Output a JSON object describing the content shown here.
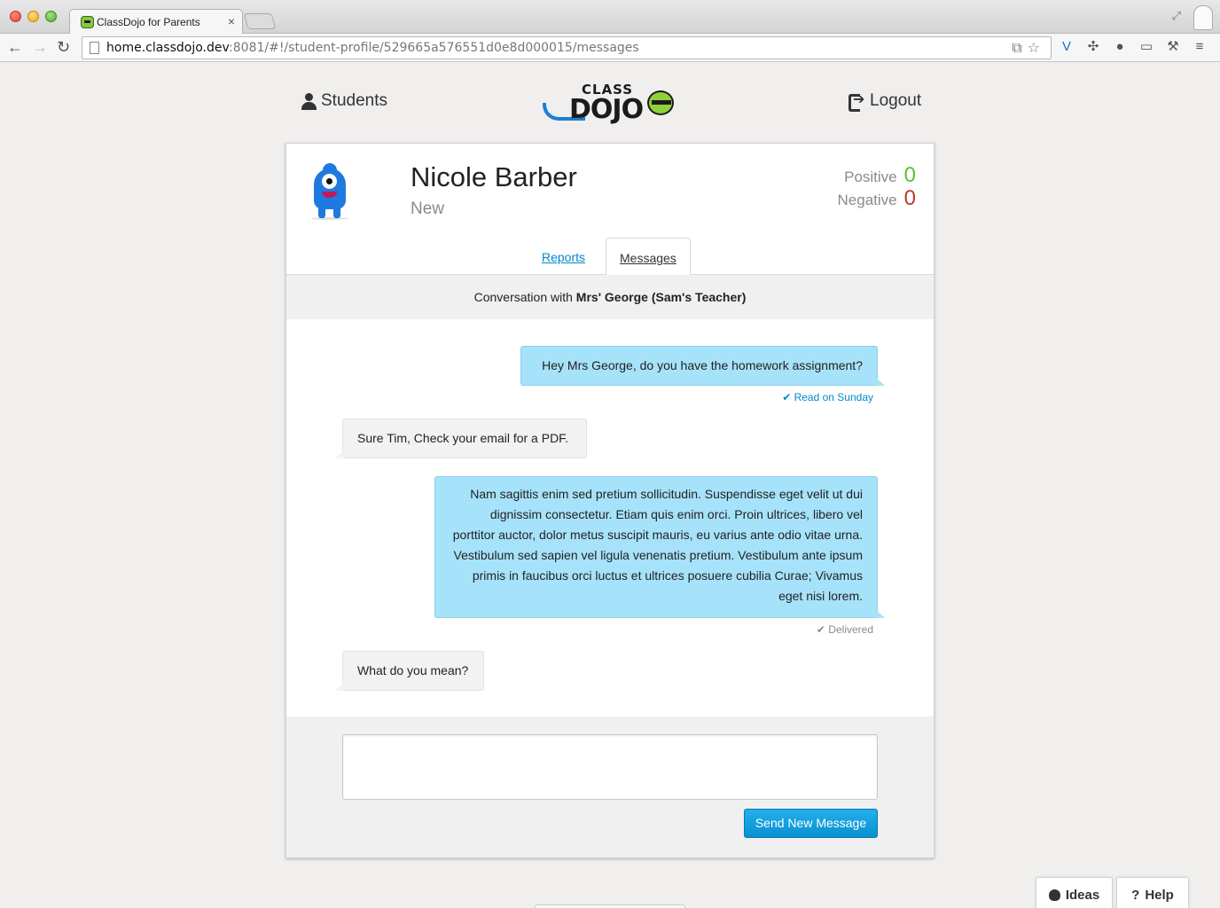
{
  "browser": {
    "tab_title": "ClassDojo for Parents",
    "tab_close": "×",
    "url_host": "home.classdojo.dev",
    "url_rest": ":8081/#!/student-profile/529665a576551d0e8d000015/messages"
  },
  "header": {
    "students_label": "Students",
    "logout_label": "Logout",
    "logo_top": "CLASS",
    "logo_bottom": "DOJO"
  },
  "student": {
    "name": "Nicole Barber",
    "status": "New",
    "positive_label": "Positive",
    "positive_value": "0",
    "negative_label": "Negative",
    "negative_value": "0"
  },
  "tabs": {
    "reports": "Reports",
    "messages": "Messages"
  },
  "conversation": {
    "prefix": "Conversation with ",
    "with": "Mrs' George (Sam's Teacher)"
  },
  "messages": [
    {
      "direction": "out",
      "text": "Hey Mrs George, do you have the homework assignment?",
      "receipt": "✔ Read on Sunday"
    },
    {
      "direction": "in",
      "text": "Sure Tim, Check your email for a PDF."
    },
    {
      "direction": "out",
      "text": "Nam sagittis enim sed pretium sollicitudin. Suspendisse eget velit ut dui dignissim consectetur. Etiam quis enim orci. Proin ultrices, libero vel porttitor auctor, dolor metus suscipit mauris, eu varius ante odio vitae urna. Vestibulum sed sapien vel ligula venenatis pretium. Vestibulum ante ipsum primis in faucibus orci luctus et ultrices posuere cubilia Curae; Vivamus eget nisi lorem.",
      "receipt": "✔ Delivered"
    },
    {
      "direction": "in",
      "text": "What do you mean?"
    }
  ],
  "compose": {
    "value": "",
    "send_label": "Send New Message"
  },
  "footer": {
    "ideas_label": "Ideas",
    "help_label": "Help",
    "help_glyph": "?"
  },
  "colors": {
    "accent": "#0088cc",
    "outgoing_bubble": "#a6e2fa",
    "positive": "#5bc236",
    "negative": "#c0392b"
  }
}
